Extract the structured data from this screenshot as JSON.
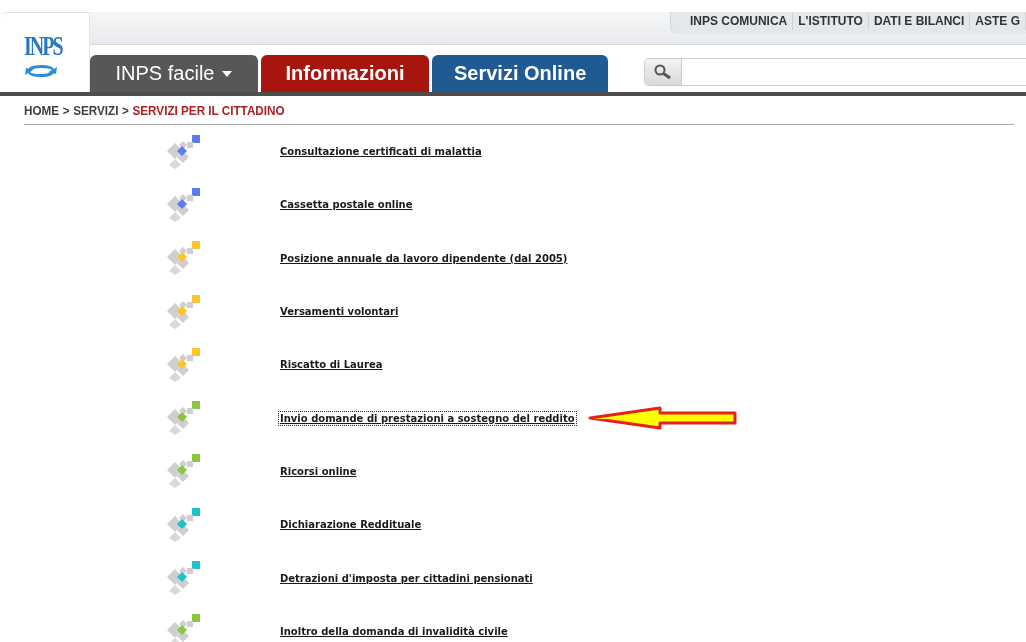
{
  "logo": {
    "text": "INPS"
  },
  "top_links": [
    "INPS COMUNICA",
    "L'ISTITUTO",
    "DATI E BILANCI",
    "ASTE G"
  ],
  "tabs": [
    {
      "label": "INPS facile",
      "color": "#575757",
      "has_menu": true
    },
    {
      "label": "Informazioni",
      "color": "#a8150f",
      "has_menu": false
    },
    {
      "label": "Servizi Online",
      "color": "#205a92",
      "has_menu": false
    }
  ],
  "breadcrumb": {
    "separator": ">",
    "items": [
      {
        "label": "HOME",
        "current": false
      },
      {
        "label": "SERVIZI",
        "current": false
      },
      {
        "label": "SERVIZI PER IL CITTADINO",
        "current": true
      }
    ]
  },
  "services": [
    {
      "label": "Consultazione certificati di malattia",
      "color": "#5b7cf0",
      "highlighted": false
    },
    {
      "label": "Cassetta postale online",
      "color": "#5b7cf0",
      "highlighted": false
    },
    {
      "label": "Posizione annuale da lavoro dipendente (dal 2005)",
      "color": "#fbc52b",
      "highlighted": false
    },
    {
      "label": "Versamenti volontari",
      "color": "#fbc52b",
      "highlighted": false
    },
    {
      "label": "Riscatto di Laurea",
      "color": "#fbc52b",
      "highlighted": false
    },
    {
      "label": "Invio domande di prestazioni a sostegno del reddito",
      "color": "#8cc63f",
      "highlighted": true
    },
    {
      "label": "Ricorsi online",
      "color": "#8cc63f",
      "highlighted": false
    },
    {
      "label": "Dichiarazione Reddituale",
      "color": "#1fc2cc",
      "highlighted": false
    },
    {
      "label": "Detrazioni d'imposta per cittadini pensionati",
      "color": "#1fc2cc",
      "highlighted": false
    },
    {
      "label": "Inoltro della domanda di invalidità civile",
      "color": "#8cc63f",
      "highlighted": false
    }
  ]
}
